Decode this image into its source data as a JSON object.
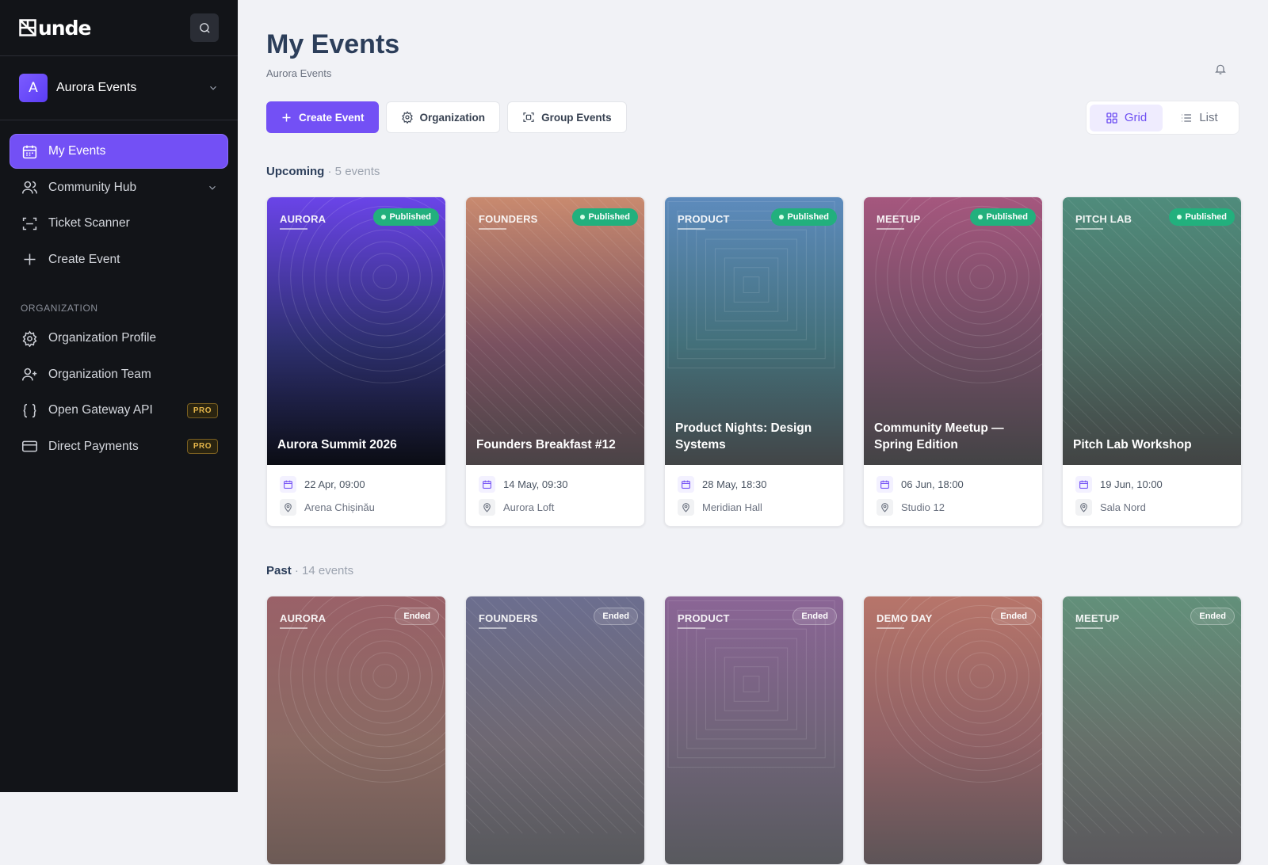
{
  "brand": {
    "logo_text": "unde"
  },
  "org": {
    "initial": "A",
    "name": "Aurora Events"
  },
  "nav": {
    "items": [
      {
        "label": "My Events",
        "icon": "calendar-icon"
      },
      {
        "label": "Community Hub",
        "icon": "users-icon"
      },
      {
        "label": "Ticket Scanner",
        "icon": "scan-icon"
      },
      {
        "label": "Create Event",
        "icon": "plus-icon"
      }
    ],
    "section_label": "ORGANIZATION",
    "org_items": [
      {
        "label": "Organization Profile",
        "icon": "gear-icon"
      },
      {
        "label": "Organization Team",
        "icon": "user-plus-icon"
      },
      {
        "label": "Open Gateway API",
        "icon": "braces-icon",
        "badge": "PRO"
      },
      {
        "label": "Direct Payments",
        "icon": "card-icon",
        "badge": "PRO"
      }
    ]
  },
  "page": {
    "title": "My Events",
    "subtitle": "Aurora Events"
  },
  "toolbar": {
    "create": "Create Event",
    "organization": "Organization",
    "group": "Group Events"
  },
  "view": {
    "grid": "Grid",
    "list": "List",
    "selected": "Grid"
  },
  "upcoming": {
    "label": "Upcoming",
    "count": "· 5 events",
    "events": [
      {
        "tag": "AURORA",
        "status": "Published",
        "title": "Aurora Summit 2026",
        "date": "22 Apr, 09:00",
        "venue": "Arena Chișinău",
        "colors": [
          "#6a44e8",
          "#2d2f6e",
          "#0b0d14"
        ]
      },
      {
        "tag": "FOUNDERS",
        "status": "Published",
        "title": "Founders Breakfast #12",
        "date": "14 May, 09:30",
        "venue": "Aurora Loft",
        "colors": [
          "#c98a6f",
          "#7a5160",
          "#4a4346"
        ]
      },
      {
        "tag": "PRODUCT",
        "status": "Published",
        "title": "Product Nights: Design Systems",
        "date": "28 May, 18:30",
        "venue": "Meridian Hall",
        "colors": [
          "#5d8bbd",
          "#43707a",
          "#424547"
        ]
      },
      {
        "tag": "MEETUP",
        "status": "Published",
        "title": "Community Meetup — Spring Edition",
        "date": "06 Jun, 18:00",
        "venue": "Studio 12",
        "colors": [
          "#a5577e",
          "#6f4d63",
          "#434345"
        ]
      },
      {
        "tag": "PITCH LAB",
        "status": "Published",
        "title": "Pitch Lab Workshop",
        "date": "19 Jun, 10:00",
        "venue": "Sala Nord",
        "colors": [
          "#4f8c7c",
          "#4d6b62",
          "#424444"
        ]
      }
    ]
  },
  "past": {
    "label": "Past",
    "count": "· 14 events",
    "events": [
      {
        "tag": "AURORA",
        "status": "Ended",
        "colors": [
          "#9a6168",
          "#8a6a63",
          "#6c5a55"
        ]
      },
      {
        "tag": "FOUNDERS",
        "status": "Ended",
        "colors": [
          "#6c6e8f",
          "#6e6872",
          "#57585c"
        ]
      },
      {
        "tag": "PRODUCT",
        "status": "Ended",
        "colors": [
          "#8b6596",
          "#6f6478",
          "#58595e"
        ]
      },
      {
        "tag": "DEMO DAY",
        "status": "Ended",
        "colors": [
          "#b7756a",
          "#8f6165",
          "#5d5457"
        ]
      },
      {
        "tag": "MEETUP",
        "status": "Ended",
        "colors": [
          "#62907a",
          "#66706a",
          "#5a585c"
        ]
      }
    ]
  }
}
